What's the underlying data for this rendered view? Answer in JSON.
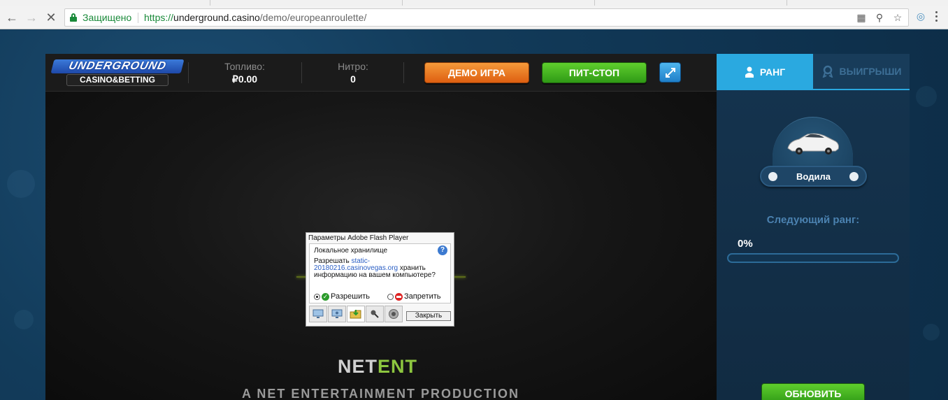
{
  "browser": {
    "secure_label": "Защищено",
    "url_scheme": "https://",
    "url_host": "underground.casino",
    "url_path": "/demo/europeanroulette/"
  },
  "header": {
    "logo_top": "UNDERGROUND",
    "logo_bottom": "CASINO&BETTING",
    "fuel_label": "Топливо:",
    "fuel_value": "₽0.00",
    "nitro_label": "Нитро:",
    "nitro_value": "0",
    "demo_button": "ДЕМО ИГРА",
    "pitstop_button": "ПИТ-СТОП"
  },
  "game": {
    "netent_net": "NET",
    "netent_ent": "ENT",
    "production": "A NET ENTERTAINMENT PRODUCTION"
  },
  "flash_dialog": {
    "title": "Параметры Adobe Flash Player",
    "heading": "Локальное хранилище",
    "text_before": "Разрешать ",
    "link": "static-20180216.casinovegas.org",
    "text_after": " хранить информацию на вашем компьютере?",
    "allow_label": "Разрешить",
    "deny_label": "Запретить",
    "close_label": "Закрыть"
  },
  "side_panel": {
    "tab_rank": "РАНГ",
    "tab_wins": "ВЫИГРЫШИ",
    "car_rank_label": "Водила",
    "next_rank_label": "Следующий ранг:",
    "progress_text": "0%",
    "progress_value": 0,
    "update_button": "ОБНОВИТЬ"
  },
  "colors": {
    "accent_blue": "#2aa9e0",
    "demo_orange": "#de5f11",
    "pitstop_green": "#2f9a16",
    "netent_green": "#8dc63f"
  }
}
